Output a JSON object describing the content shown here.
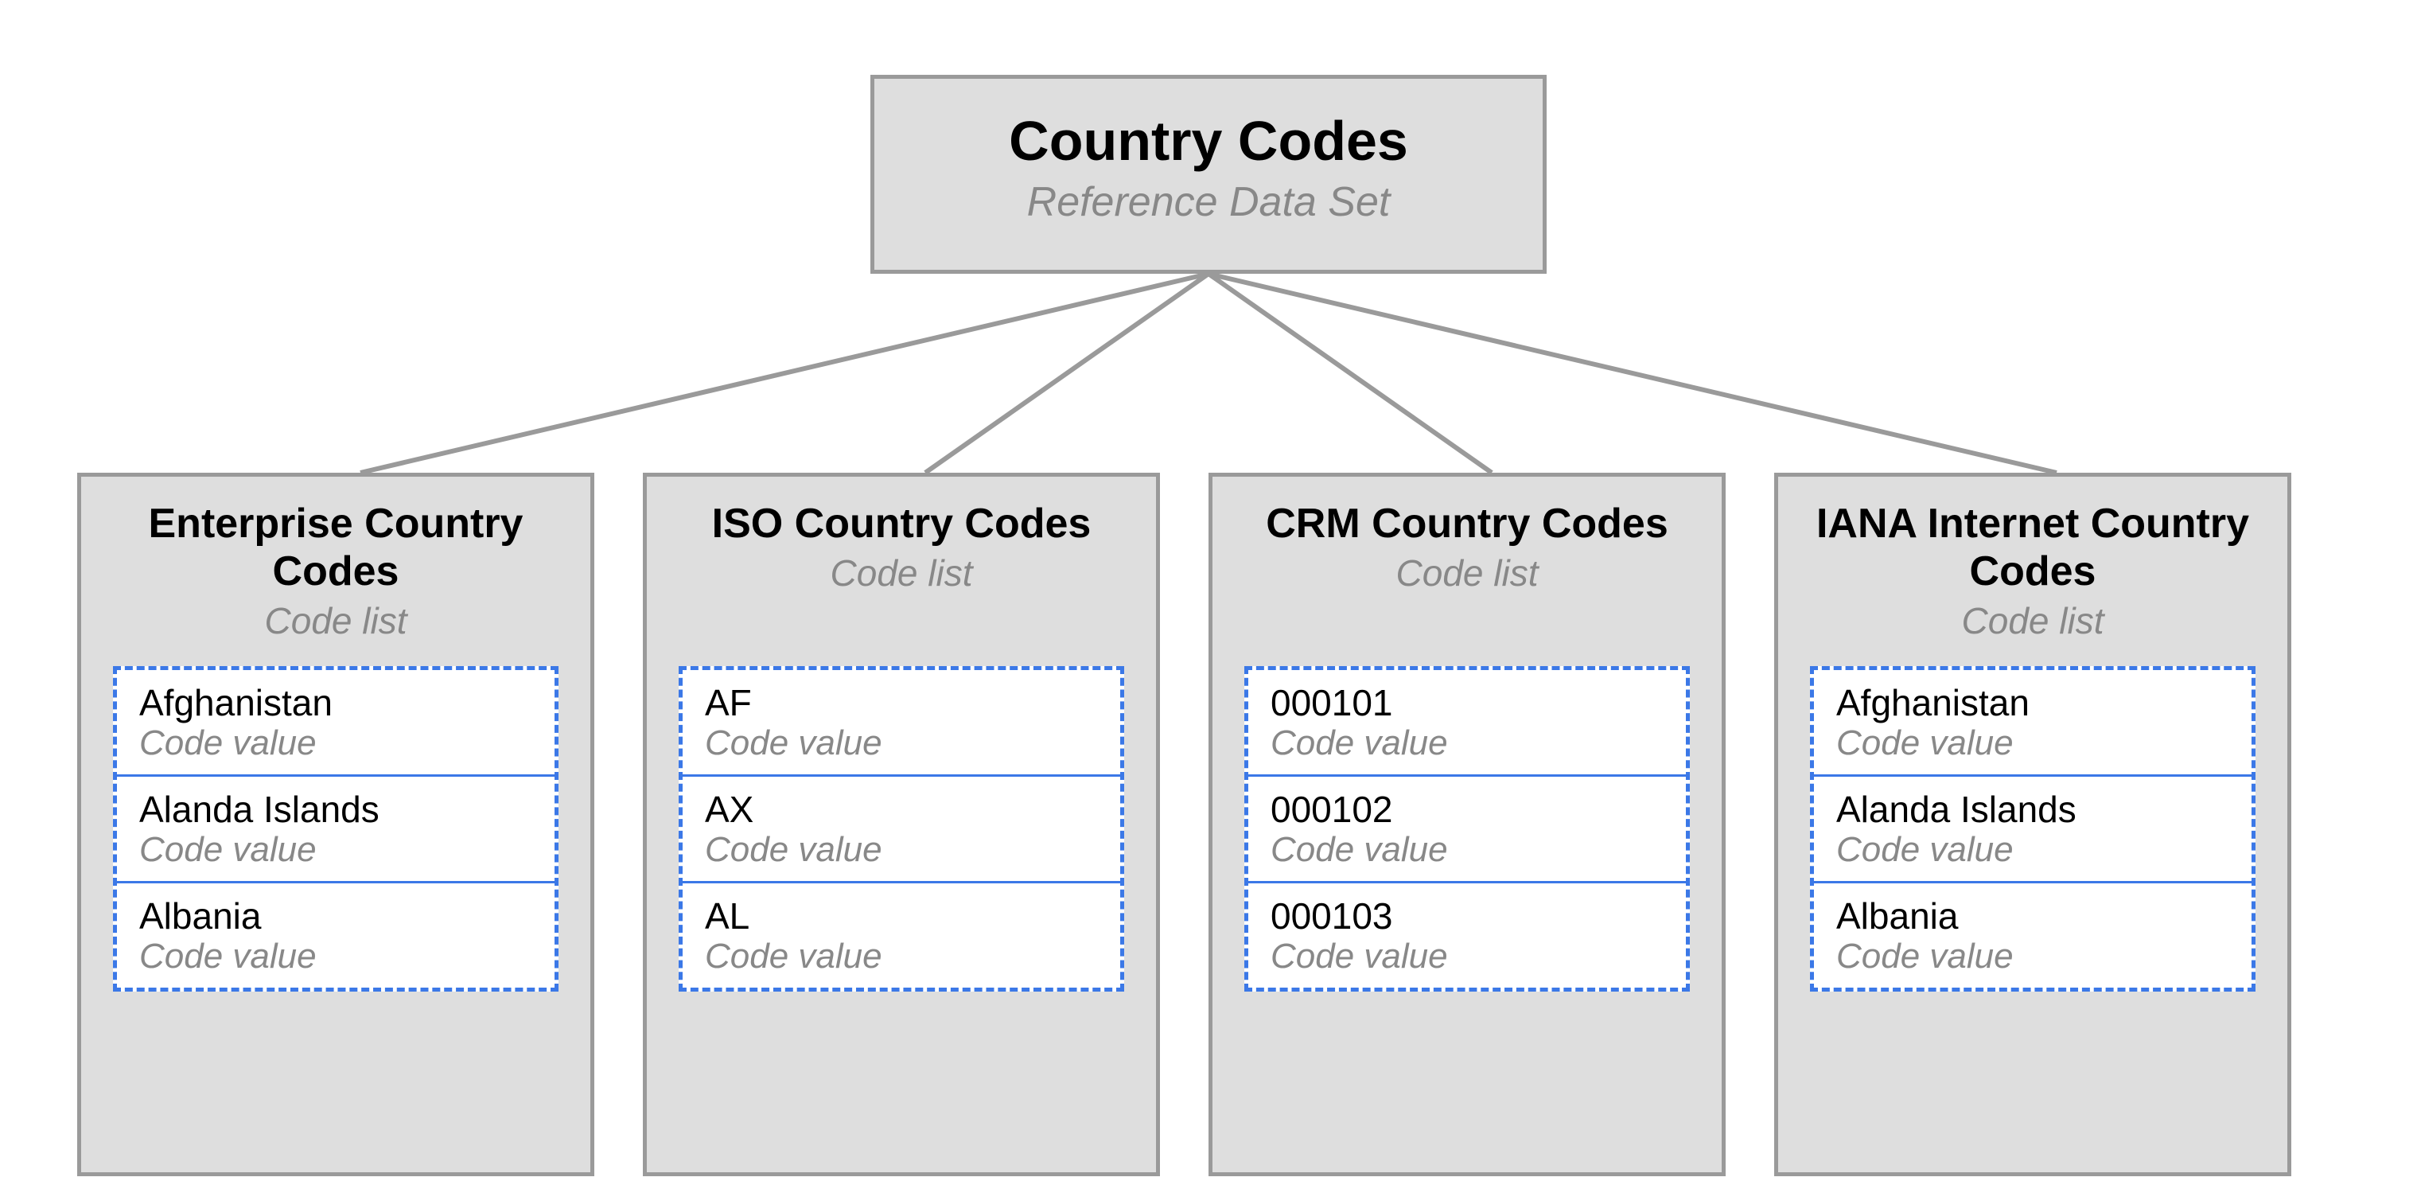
{
  "root": {
    "title": "Country Codes",
    "subtitle": "Reference Data Set"
  },
  "children": [
    {
      "title": "Enterprise Country Codes",
      "subtitle": "Code list",
      "values": [
        {
          "name": "Afghanistan",
          "sub": "Code value"
        },
        {
          "name": "Alanda Islands",
          "sub": "Code value"
        },
        {
          "name": "Albania",
          "sub": "Code value"
        }
      ]
    },
    {
      "title": "ISO Country Codes",
      "subtitle": "Code list",
      "values": [
        {
          "name": "AF",
          "sub": "Code value"
        },
        {
          "name": "AX",
          "sub": "Code value"
        },
        {
          "name": "AL",
          "sub": "Code value"
        }
      ]
    },
    {
      "title": "CRM Country Codes",
      "subtitle": "Code list",
      "values": [
        {
          "name": "000101",
          "sub": "Code value"
        },
        {
          "name": "000102",
          "sub": "Code value"
        },
        {
          "name": "000103",
          "sub": "Code value"
        }
      ]
    },
    {
      "title": "IANA Internet Country Codes",
      "subtitle": "Code list",
      "values": [
        {
          "name": "Afghanistan",
          "sub": "Code value"
        },
        {
          "name": "Alanda Islands",
          "sub": "Code value"
        },
        {
          "name": "Albania",
          "sub": "Code value"
        }
      ]
    }
  ]
}
